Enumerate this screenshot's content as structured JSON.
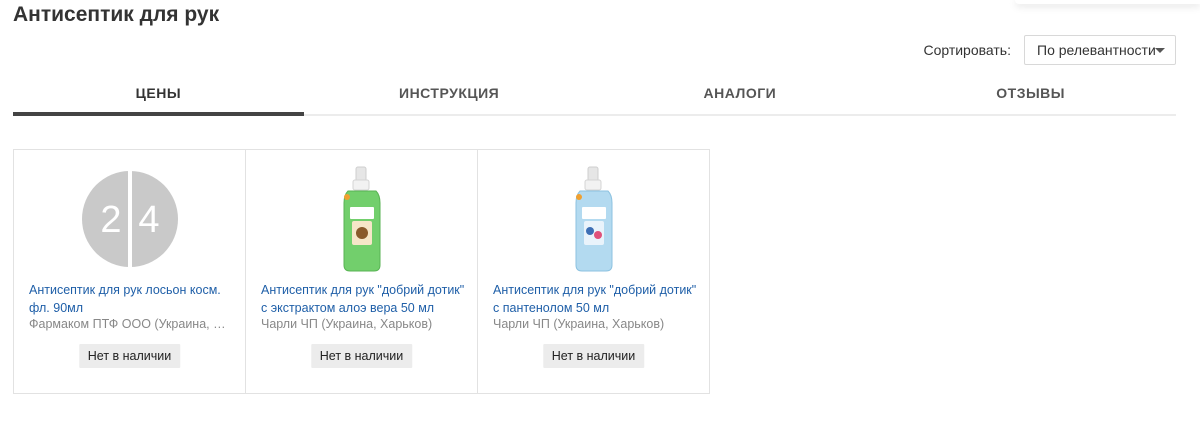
{
  "page": {
    "title": "Антисептик для рук"
  },
  "sort": {
    "label": "Сортировать:",
    "selected": "По релевантности"
  },
  "tabs": [
    {
      "label": "ЦЕНЫ",
      "active": true
    },
    {
      "label": "ИНСТРУКЦИЯ",
      "active": false
    },
    {
      "label": "АНАЛОГИ",
      "active": false
    },
    {
      "label": "ОТЗЫВЫ",
      "active": false
    }
  ],
  "products": [
    {
      "name": "Антисептик для рук лосьон косм. фл. 90мл",
      "maker": "Фармаком ПТФ ООО (Украина, Хар...",
      "status": "Нет в наличии",
      "image": {
        "icon": "placeholder-logo-icon",
        "text": "24"
      }
    },
    {
      "name": "Антисептик для рук \"добрий дотик\" с экстрактом алоэ вера 50 мл",
      "maker": "Чарли ЧП (Украина, Харьков)",
      "status": "Нет в наличии",
      "image": {
        "icon": "green-bottle-icon",
        "color": "#6fcf6a"
      }
    },
    {
      "name": "Антисептик для рук \"добрий дотик\" с пантенолом 50 мл",
      "maker": "Чарли ЧП (Украина, Харьков)",
      "status": "Нет в наличии",
      "image": {
        "icon": "blue-bottle-icon",
        "color": "#a9d4ea"
      }
    }
  ],
  "colors": {
    "link": "#1f5fa8",
    "tab_active_underline": "#444444",
    "status_bg": "#ececec"
  }
}
